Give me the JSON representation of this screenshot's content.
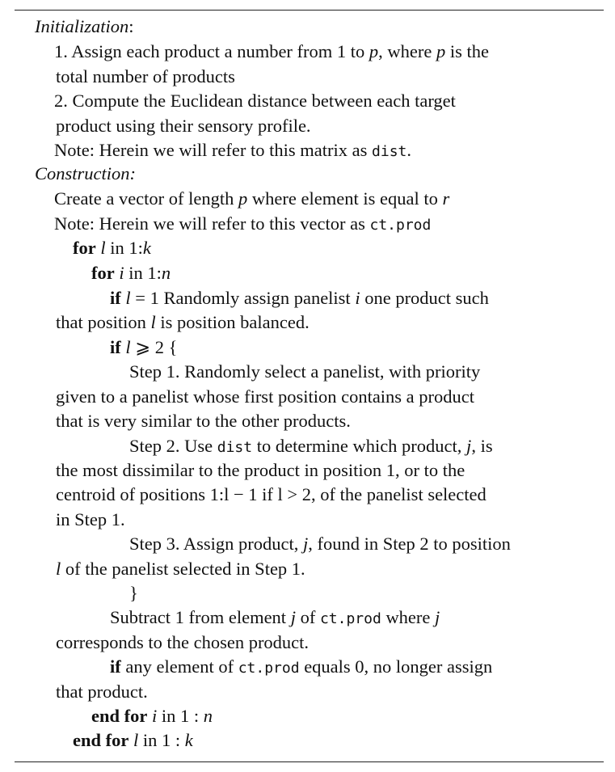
{
  "init": {
    "heading": "Initialization",
    "colon": ":",
    "s1a": "1. Assign each product a number from 1 to ",
    "p": "p",
    "s1b": ", where ",
    "s1c": " is the",
    "s1d": "total number of products",
    "s2a": "2. Compute the Euclidean distance between each target",
    "s2b": "product using their sensory profile.",
    "note": "Note: Herein we will refer to this matrix as ",
    "dist": "dist",
    "period": "."
  },
  "cons": {
    "heading": "Construction:",
    "vec_a": "Create a vector of length ",
    "vec_b": " where element is equal to ",
    "r": "r",
    "note": "Note: Herein we will refer to this vector as ",
    "ctprod": "ct.prod",
    "for": "for",
    "l": "l",
    "i": "i",
    "k": "k",
    "n": "n",
    "in1": " in 1:",
    "if": "if",
    "if1_cond": " = 1 Randomly assign panelist ",
    "if1_rest": " one product such",
    "if1_cont_a": "that position ",
    "if1_cont_b": " is position balanced.",
    "if2_cond": " ⩾ 2 {",
    "step1a": "Step 1. Randomly select a panelist, with priority",
    "step1b": "given to a panelist whose first position contains a product",
    "step1c": "that is very similar to the other products.",
    "step2a_pre": "Step 2. Use ",
    "step2a_post": " to determine which product, ",
    "j": "j",
    "step2a_end": ", is",
    "step2b": "the most dissimilar to the product in position 1, or to the",
    "step2c": "centroid of positions 1:l − 1 if l > 2, of the panelist selected",
    "step2d": "in Step 1.",
    "step3a_pre": "Step 3. Assign product, ",
    "step3a_post": ", found in Step 2 to position",
    "step3b": " of the panelist selected in Step 1.",
    "brace": "}",
    "sub_a": "Subtract 1 from element ",
    "sub_b": " of ",
    "sub_c": " where ",
    "sub_d": "corresponds to the chosen product.",
    "any_a": " any element of ",
    "any_b": " equals 0, no longer assign",
    "any_c": "that product.",
    "endfor": "end for",
    "in1sp": " in 1 : "
  }
}
